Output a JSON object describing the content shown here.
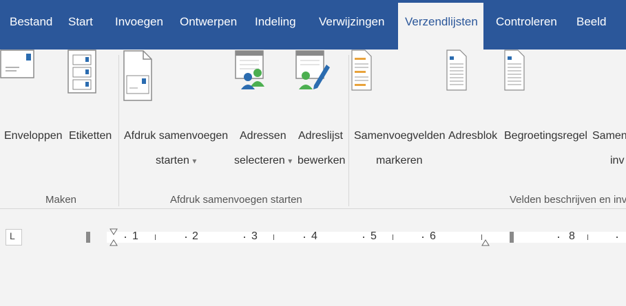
{
  "tabs": [
    {
      "label": "Bestand",
      "active": false
    },
    {
      "label": "Start",
      "active": false
    },
    {
      "label": "Invoegen",
      "active": false
    },
    {
      "label": "Ontwerpen",
      "active": false
    },
    {
      "label": "Indeling",
      "active": false
    },
    {
      "label": "Verwijzingen",
      "active": false
    },
    {
      "label": "Verzendlijsten",
      "active": true
    },
    {
      "label": "Controleren",
      "active": false
    },
    {
      "label": "Beeld",
      "active": false
    }
  ],
  "ribbon": {
    "groups": [
      {
        "label": "Maken"
      },
      {
        "label": "Afdruk samenvoegen starten"
      },
      {
        "label": "Velden beschrijven en invo"
      }
    ],
    "buttons": {
      "envelopes": {
        "line1": "Enveloppen"
      },
      "labels": {
        "line1": "Etiketten"
      },
      "start_mail_merge": {
        "line1": "Afdruk samenvoegen",
        "line2": "starten",
        "dropdown": "▾"
      },
      "select_recipients": {
        "line1": "Adressen",
        "line2": "selecteren",
        "dropdown": "▾"
      },
      "edit_recipient_list": {
        "line1": "Adreslijst",
        "line2": "bewerken"
      },
      "highlight_merge_fields": {
        "line1": "Samenvoegvelden",
        "line2": "markeren"
      },
      "address_block": {
        "line1": "Adresblok"
      },
      "greeting_line": {
        "line1": "Begroetingsregel"
      },
      "insert_merge_field": {
        "line1": "Samen",
        "line2": "inv"
      }
    }
  },
  "ruler": {
    "tab_selector": "L",
    "numbers": [
      "1",
      "2",
      "3",
      "4",
      "5",
      "6",
      "8"
    ]
  },
  "colors": {
    "tab_bar": "#2b579a",
    "ribbon_bg": "#f3f3f3",
    "icon_blue": "#2b6cb0",
    "icon_green": "#4caf50"
  }
}
